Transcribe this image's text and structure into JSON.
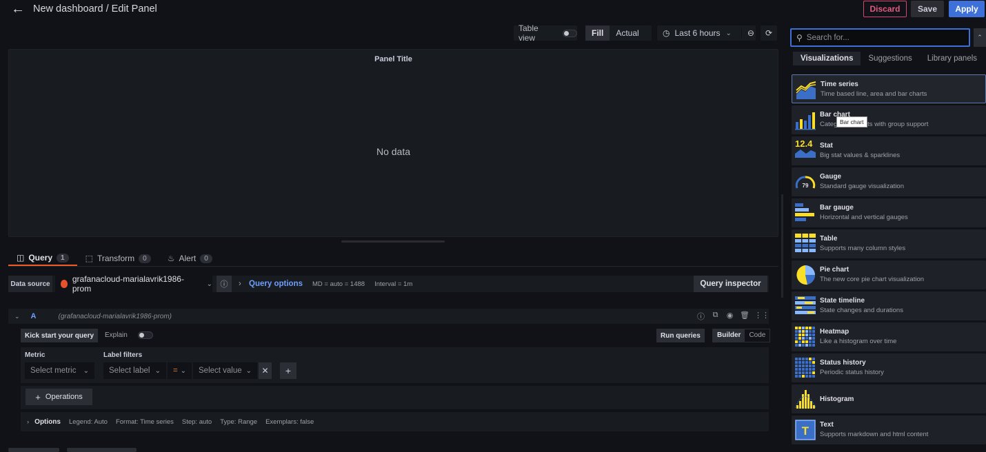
{
  "header": {
    "title": "New dashboard / Edit Panel",
    "discard": "Discard",
    "save": "Save",
    "apply": "Apply"
  },
  "toolbar": {
    "table_view": "Table view",
    "table_view_on": false,
    "fill": "Fill",
    "actual": "Actual",
    "time_range": "Last 6 hours"
  },
  "panel": {
    "title": "Panel Title",
    "no_data": "No data"
  },
  "tabs": [
    {
      "label": "Query",
      "count": "1",
      "active": true
    },
    {
      "label": "Transform",
      "count": "0"
    },
    {
      "label": "Alert",
      "count": "0"
    }
  ],
  "datasource": {
    "label": "Data source",
    "value": "grafanacloud-marialavrik1986-prom",
    "query_options": "Query options",
    "md": "MD = auto = 1488",
    "interval": "Interval = 1m",
    "query_inspector": "Query inspector"
  },
  "query": {
    "ref": "A",
    "ds": "(grafanacloud-marialavrik1986-prom)",
    "kick_start": "Kick start your query",
    "explain": "Explain",
    "run_queries": "Run queries",
    "builder": "Builder",
    "code": "Code",
    "metric_label": "Metric",
    "metric_placeholder": "Select metric",
    "label_filters": "Label filters",
    "label_placeholder": "Select label",
    "operator": "=",
    "value_placeholder": "Select value",
    "operations": "Operations",
    "options": "Options",
    "options_meta": [
      "Legend: Auto",
      "Format: Time series",
      "Step: auto",
      "Type: Range",
      "Exemplars: false"
    ]
  },
  "sidebar": {
    "search_placeholder": "Search for...",
    "tabs": [
      "Visualizations",
      "Suggestions",
      "Library panels"
    ],
    "tooltip": "Bar chart",
    "items": [
      {
        "name": "Time series",
        "desc": "Time based line, area and bar charts",
        "icon": "time-series-icon"
      },
      {
        "name": "Bar chart",
        "desc": "Categorical charts with group support",
        "icon": "bar-chart-icon"
      },
      {
        "name": "Stat",
        "desc": "Big stat values & sparklines",
        "icon": "stat-icon",
        "stat_value": "12.4"
      },
      {
        "name": "Gauge",
        "desc": "Standard gauge visualization",
        "icon": "gauge-icon",
        "gauge_value": "79"
      },
      {
        "name": "Bar gauge",
        "desc": "Horizontal and vertical gauges",
        "icon": "bar-gauge-icon"
      },
      {
        "name": "Table",
        "desc": "Supports many column styles",
        "icon": "table-icon"
      },
      {
        "name": "Pie chart",
        "desc": "The new core pie chart visualization",
        "icon": "pie-chart-icon"
      },
      {
        "name": "State timeline",
        "desc": "State changes and durations",
        "icon": "state-timeline-icon"
      },
      {
        "name": "Heatmap",
        "desc": "Like a histogram over time",
        "icon": "heatmap-icon"
      },
      {
        "name": "Status history",
        "desc": "Periodic status history",
        "icon": "status-history-icon"
      },
      {
        "name": "Histogram",
        "desc": "",
        "icon": "histogram-icon"
      },
      {
        "name": "Text",
        "desc": "Supports markdown and html content",
        "icon": "text-icon"
      }
    ]
  },
  "colors": {
    "accent_blue": "#3d71d9",
    "discard": "#e35b7f",
    "tab_active": "#f05a28",
    "viz_yellow": "#fade2a",
    "viz_blue": "#3b6fc7"
  }
}
